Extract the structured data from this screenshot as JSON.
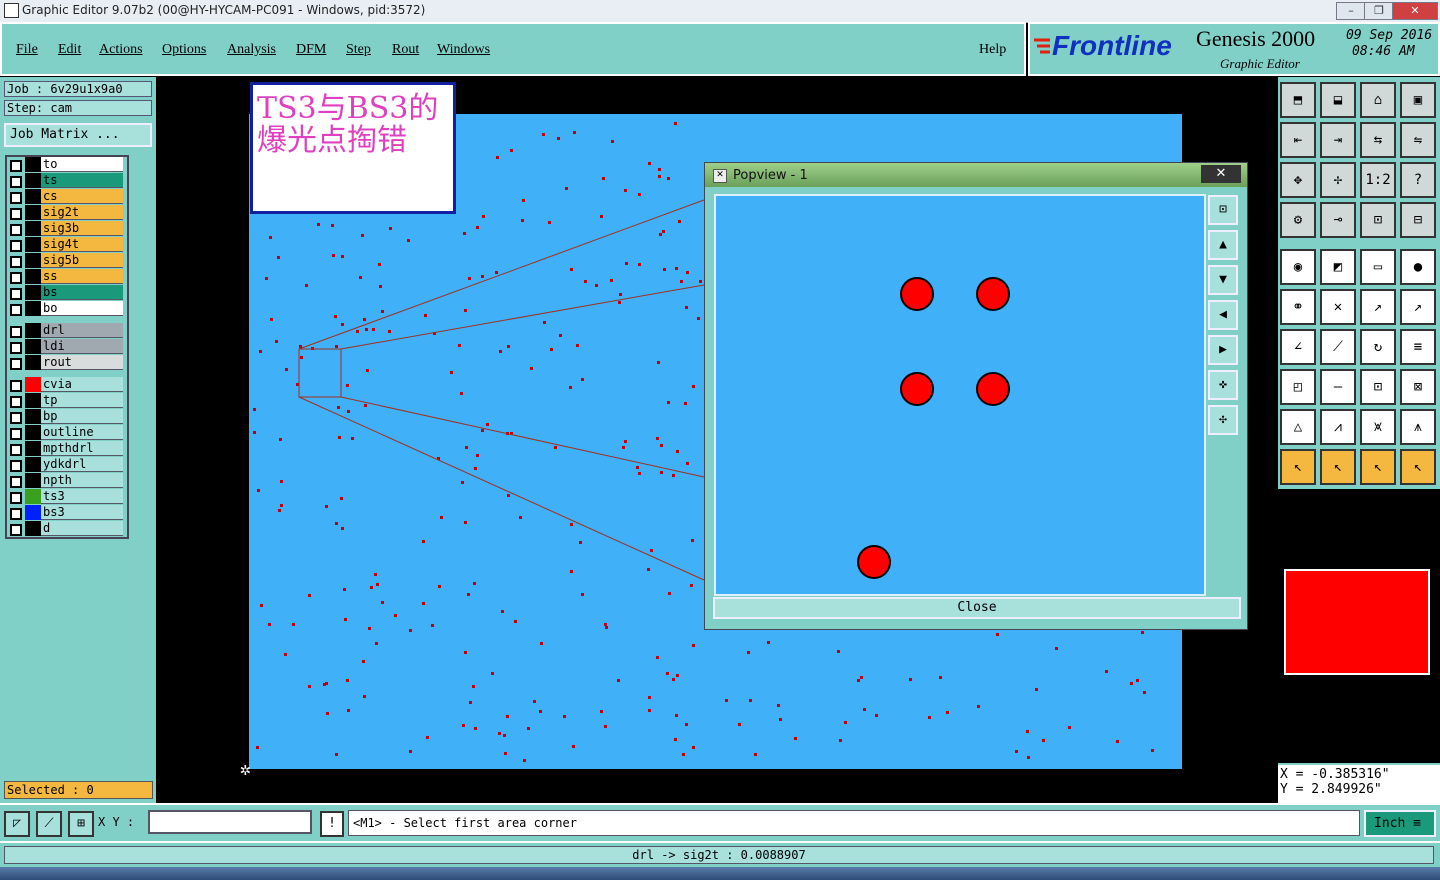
{
  "window": {
    "title": "Graphic Editor 9.07b2 (00@HY-HYCAM-PC091 - Windows, pid:3572)"
  },
  "menu": {
    "items": [
      "File",
      "Edit",
      "Actions",
      "Options",
      "Analysis",
      "DFM",
      "Step",
      "Rout",
      "Windows"
    ],
    "help": "Help"
  },
  "brand": {
    "logo": "Frontline",
    "product": "Genesis 2000",
    "subtitle": "Graphic Editor",
    "date": "09 Sep 2016",
    "time": "08:46 AM"
  },
  "job": {
    "job_line": "Job : 6v29u1x9a0",
    "step_line": "Step: cam",
    "matrix_button": "Job Matrix ..."
  },
  "colors": {
    "panel": "#80d0c8",
    "board": "#40b0f8",
    "pad": "#ff0000",
    "note_text": "#e040c0",
    "layer_orange": "#f4b840",
    "layer_green": "#1a9a7a"
  },
  "layers": [
    {
      "name": "to",
      "color": "#ffffff",
      "swatch": "#000000"
    },
    {
      "name": "ts",
      "color": "#1a9a7a",
      "swatch": "#000000"
    },
    {
      "name": "cs",
      "color": "#f4b840",
      "swatch": "#000000"
    },
    {
      "name": "sig2t",
      "color": "#f4b840",
      "swatch": "#000000"
    },
    {
      "name": "sig3b",
      "color": "#f4b840",
      "swatch": "#000000"
    },
    {
      "name": "sig4t",
      "color": "#f4b840",
      "swatch": "#000000"
    },
    {
      "name": "sig5b",
      "color": "#f4b840",
      "swatch": "#000000"
    },
    {
      "name": "ss",
      "color": "#f4b840",
      "swatch": "#000000"
    },
    {
      "name": "bs",
      "color": "#1a9a7a",
      "swatch": "#000000"
    },
    {
      "name": "bo",
      "color": "#ffffff",
      "swatch": "#000000"
    },
    {
      "name": "drl",
      "color": "#a0a8b0",
      "swatch": "#000000"
    },
    {
      "name": "ldi",
      "color": "#a0a8b0",
      "swatch": "#000000"
    },
    {
      "name": "rout",
      "color": "#d8dcdc",
      "swatch": "#000000"
    },
    {
      "name": "cvia",
      "color": "#a8e0dc",
      "swatch": "#ff0000"
    },
    {
      "name": "tp",
      "color": "#a8e0dc",
      "swatch": "#000000"
    },
    {
      "name": "bp",
      "color": "#a8e0dc",
      "swatch": "#000000"
    },
    {
      "name": "outline",
      "color": "#a8e0dc",
      "swatch": "#000000"
    },
    {
      "name": "mpthdrl",
      "color": "#a8e0dc",
      "swatch": "#000000"
    },
    {
      "name": "ydkdrl",
      "color": "#a8e0dc",
      "swatch": "#000000"
    },
    {
      "name": "npth",
      "color": "#a8e0dc",
      "swatch": "#000000"
    },
    {
      "name": "ts3",
      "color": "#a8e0dc",
      "swatch": "#3aa020"
    },
    {
      "name": "bs3",
      "color": "#a8e0dc",
      "swatch": "#0020ff"
    },
    {
      "name": "d",
      "color": "#a8e0dc",
      "swatch": "#000000"
    }
  ],
  "selected": "Selected : 0",
  "note": {
    "line1": "TS3与BS3的",
    "line2": "爆光点掏错"
  },
  "popview": {
    "title": "Popview - 1",
    "close_x": "✕",
    "close_button": "Close"
  },
  "coords": {
    "x": "X = -0.385316\"",
    "y": "Y = 2.849926\""
  },
  "command": {
    "xy_label": "X Y :",
    "xy_value": "",
    "prompt": "<M1> - Select first area corner",
    "units": "Inch"
  },
  "status": "drl -> sig2t : 0.0088907"
}
